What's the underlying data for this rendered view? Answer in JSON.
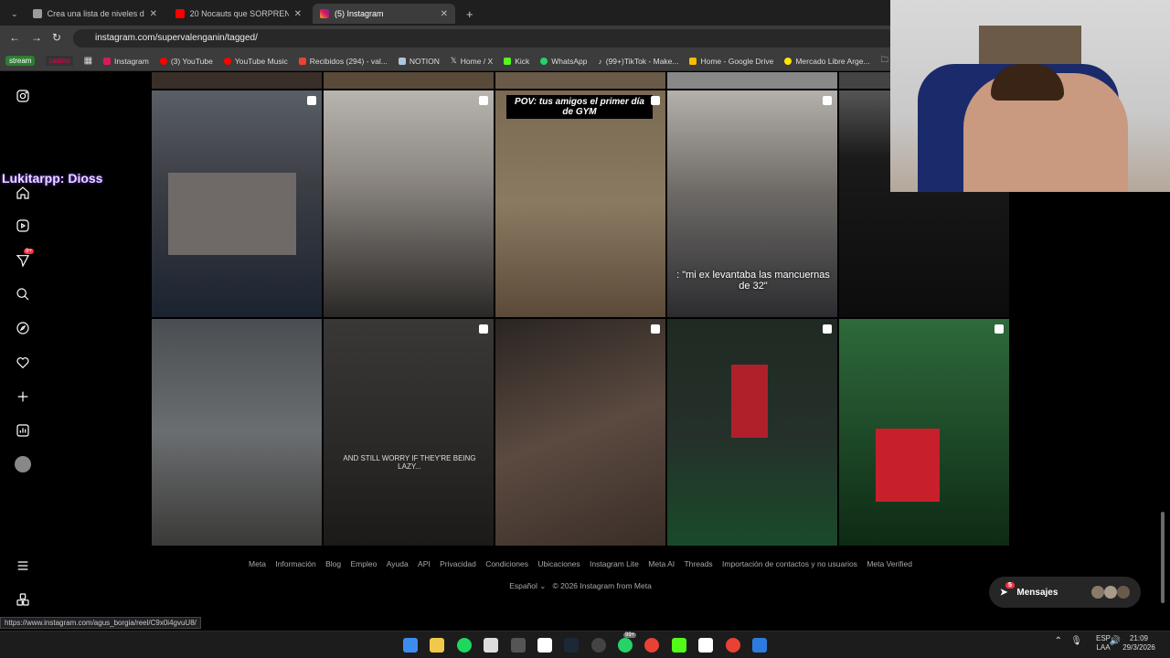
{
  "tabs": [
    {
      "label": "Crea una lista de niveles de tod"
    },
    {
      "label": "20 Nocauts que SORPRENDIER"
    },
    {
      "label": "(5) Instagram"
    }
  ],
  "address": {
    "url": "instagram.com/supervalenganin/tagged/"
  },
  "bookmarks": [
    "stream",
    "casino",
    "Instagram",
    "(3) YouTube",
    "YouTube Music",
    "Recibidos (294) - val...",
    "NOTION",
    "Home / X",
    "Kick",
    "WhatsApp",
    "(99+)TikTok - Make...",
    "Home - Google Drive",
    "Mercado Libre Arge..."
  ],
  "sidebar": {
    "badge": "9+"
  },
  "overlay": {
    "stream_text": "Lukitarpp: Dioss"
  },
  "posts": [
    {
      "caption": ""
    },
    {
      "caption": ""
    },
    {
      "caption": "POV: tus amigos el primer día de GYM"
    },
    {
      "caption": ": \"mi ex levantaba las mancuernas de 32\""
    },
    {
      "caption": ""
    },
    {
      "caption": ""
    },
    {
      "caption": "AND STILL WORRY IF THEY'RE BEING LAZY..."
    },
    {
      "caption": ""
    },
    {
      "caption": ""
    },
    {
      "caption": ""
    }
  ],
  "footer": {
    "links": [
      "Meta",
      "Información",
      "Blog",
      "Empleo",
      "Ayuda",
      "API",
      "Privacidad",
      "Condiciones",
      "Ubicaciones",
      "Instagram Lite",
      "Meta AI",
      "Threads",
      "Importación de contactos y no usuarios",
      "Meta Verified"
    ],
    "language": "Español",
    "copyright": "© 2026 Instagram from Meta"
  },
  "messages": {
    "label": "Mensajes",
    "badge": "5"
  },
  "status_url": "https://www.instagram.com/agus_borgia/reel/C9x0i4gvuU8/",
  "taskbar": {
    "lang": "ESP",
    "lang2": "LAA",
    "time": "21:09",
    "date": "29/3/2026",
    "badge": "99+"
  }
}
